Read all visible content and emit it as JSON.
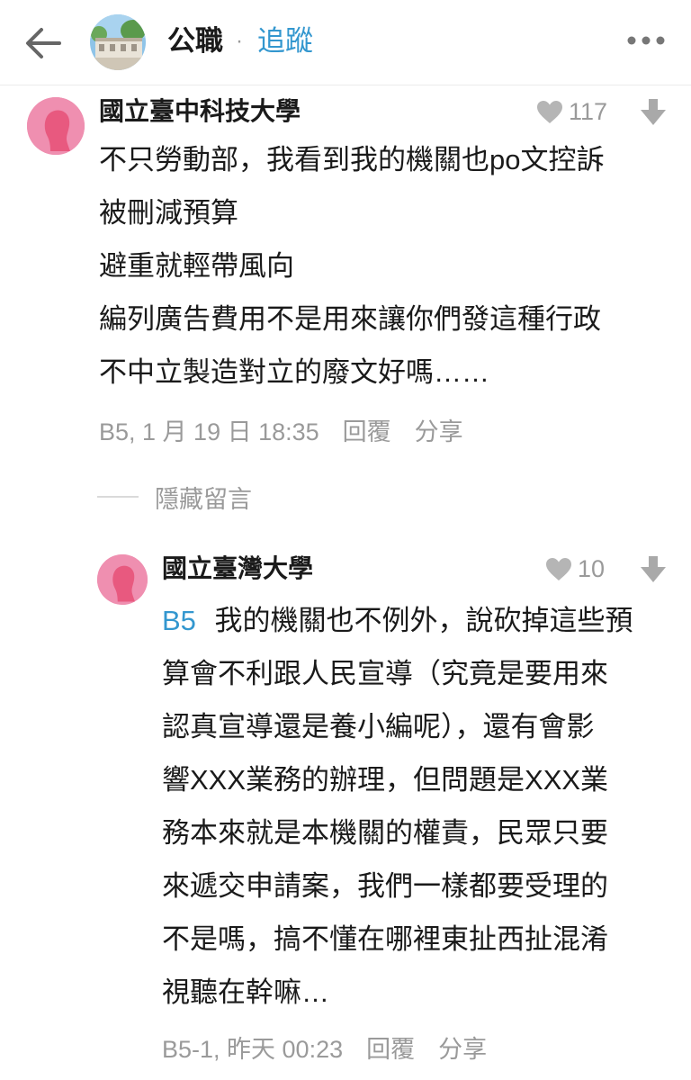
{
  "header": {
    "board_name": "公職",
    "separator": "·",
    "follow_label": "追蹤"
  },
  "comments": [
    {
      "author": "國立臺中科技大學",
      "likes": "117",
      "lines": [
        "不只勞動部，我看到我的機關也po文控訴",
        "被刪減預算",
        "避重就輕帶風向",
        "編列廣告費用不是用來讓你們發這種行政",
        "不中立製造對立的廢文好嗎……"
      ],
      "floor_time": "B5, 1 月 19 日 18:35",
      "reply_label": "回覆",
      "share_label": "分享"
    }
  ],
  "hide_comments_label": "隱藏留言",
  "reply": {
    "author": "國立臺灣大學",
    "likes": "10",
    "ref_tag": "B5",
    "lines": [
      "我的機關也不例外，說砍掉這些預",
      "算會不利跟人民宣導（究竟是要用來",
      "認真宣導還是養小編呢），還有會影",
      "響XXX業務的辦理，但問題是XXX業",
      "務本來就是本機關的權責，民眾只要",
      "來遞交申請案，我們一樣都要受理的",
      "不是嗎，搞不懂在哪裡東扯西扯混淆",
      "視聽在幹嘛…"
    ],
    "floor_time": "B5-1, 昨天 00:23",
    "reply_label": "回覆",
    "share_label": "分享"
  },
  "colors": {
    "accent": "#3397cf",
    "muted": "#9a9a9a",
    "avatar_pink": "#ef8fb0"
  },
  "icons": [
    "back-arrow-icon",
    "more-options-icon",
    "heart-icon",
    "downvote-icon",
    "female-avatar-icon"
  ]
}
